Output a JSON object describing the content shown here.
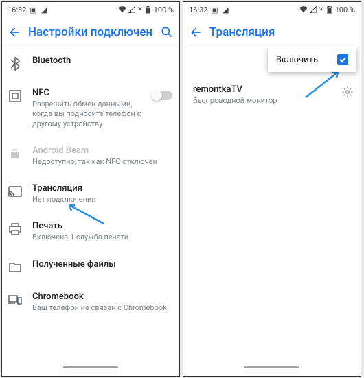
{
  "status": {
    "time": "16:32",
    "battery": "100 %"
  },
  "left": {
    "title": "Настройки подключения",
    "items": [
      {
        "title": "Bluetooth",
        "sub": ""
      },
      {
        "title": "NFC",
        "sub": "Разрешить обмен данными, когда вы подносите телефон к другому устройству"
      },
      {
        "title": "Android Beam",
        "sub": "Недоступно, так как NFC отключен"
      },
      {
        "title": "Трансляция",
        "sub": "Нет подключения"
      },
      {
        "title": "Печать",
        "sub": "Включена 1 служба печати"
      },
      {
        "title": "Полученные файлы",
        "sub": ""
      },
      {
        "title": "Chromebook",
        "sub": "Ваш телефон не связан c Chromebook"
      }
    ]
  },
  "right": {
    "title": "Трансляция",
    "popup": {
      "label": "Включить"
    },
    "device": {
      "title": "remontkaTV",
      "sub": "Беспроводной монитор"
    }
  }
}
